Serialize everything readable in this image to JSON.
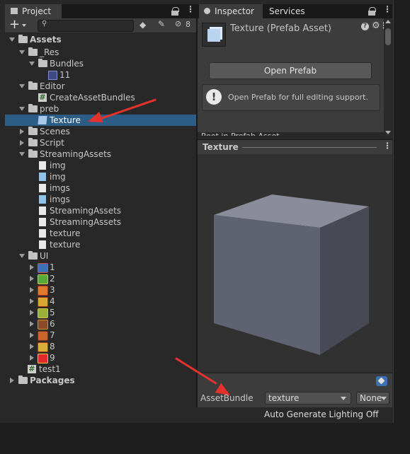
{
  "project_panel": {
    "tab_label": "Project",
    "hidden_count": "8",
    "tree": [
      {
        "label": "Assets",
        "bold": true
      },
      {
        "label": "_Res"
      },
      {
        "label": "Bundles"
      },
      {
        "label": "11"
      },
      {
        "label": "Editor"
      },
      {
        "label": "CreateAssetBundles"
      },
      {
        "label": "preb"
      },
      {
        "label": "Texture",
        "selected": true
      },
      {
        "label": "Scenes"
      },
      {
        "label": "Script"
      },
      {
        "label": "StreamingAssets"
      },
      {
        "label": "img"
      },
      {
        "label": "img"
      },
      {
        "label": "imgs"
      },
      {
        "label": "imgs"
      },
      {
        "label": "StreamingAssets"
      },
      {
        "label": "StreamingAssets"
      },
      {
        "label": "texture"
      },
      {
        "label": "texture"
      },
      {
        "label": "UI"
      },
      {
        "label": "1"
      },
      {
        "label": "2"
      },
      {
        "label": "3"
      },
      {
        "label": "4"
      },
      {
        "label": "5"
      },
      {
        "label": "6"
      },
      {
        "label": "7"
      },
      {
        "label": "8"
      },
      {
        "label": "9"
      },
      {
        "label": "test1"
      },
      {
        "label": "Packages",
        "bold": true
      }
    ]
  },
  "inspector": {
    "tabs": [
      "Inspector",
      "Services"
    ],
    "asset_title": "Texture (Prefab Asset)",
    "open_prefab_label": "Open Prefab",
    "help_text": "Open Prefab for full editing support.",
    "cut_off_text": "Root in Prefab Asset"
  },
  "preview": {
    "title": "Texture",
    "assetbundle_label": "AssetBundle",
    "assetbundle_value": "texture",
    "variant_value": "None"
  },
  "status_bar": {
    "text": "Auto Generate Lighting Off"
  },
  "colors": {
    "selection": "#2c5d87",
    "annotation_arrow": "#e5322d",
    "panel_bg": "#282828",
    "inspector_bg": "#3c3c3c"
  }
}
